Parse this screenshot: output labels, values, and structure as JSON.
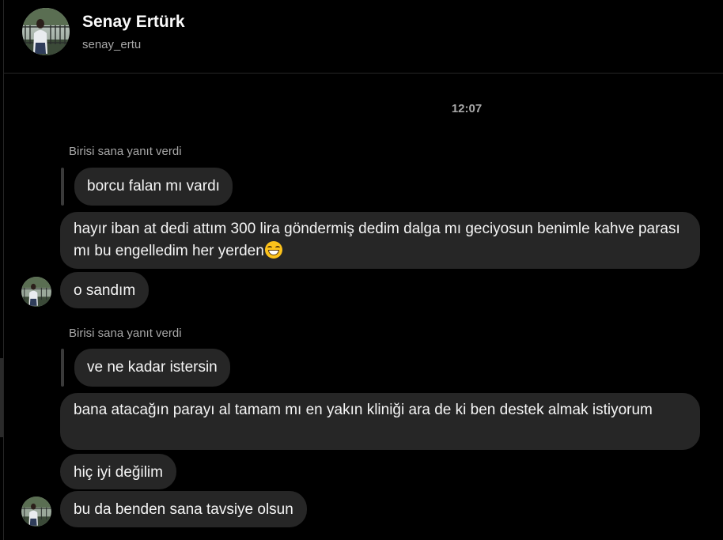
{
  "contact": {
    "name": "Senay Ertürk",
    "username": "senay_ertu",
    "avatar_icon": "profile-photo"
  },
  "conversation": {
    "timestamp": "12:07",
    "reply_groups": [
      {
        "reply_label": "Birisi sana yanıt verdi",
        "quoted_text": "borcu falan mı vardı",
        "messages": [
          {
            "text": "hayır iban at dedi attım 300 lira göndermiş dedim dalga mı geciyosun benimle kahve parası mı bu engelledim her yerden",
            "emoji": "grinning-squinting-face"
          },
          {
            "text": "o sandım"
          }
        ]
      },
      {
        "reply_label": "Birisi sana yanıt verdi",
        "quoted_text": "ve ne kadar istersin",
        "messages": [
          {
            "text": "bana atacağın parayı al tamam mı en yakın kliniği ara de ki ben destek almak istiyorum"
          },
          {
            "text": "hiç iyi değilim"
          },
          {
            "text": "bu da benden sana tavsiye olsun"
          }
        ]
      }
    ]
  },
  "colors": {
    "background": "#000000",
    "bubble": "#262626",
    "muted_text": "#a8a8a8"
  }
}
